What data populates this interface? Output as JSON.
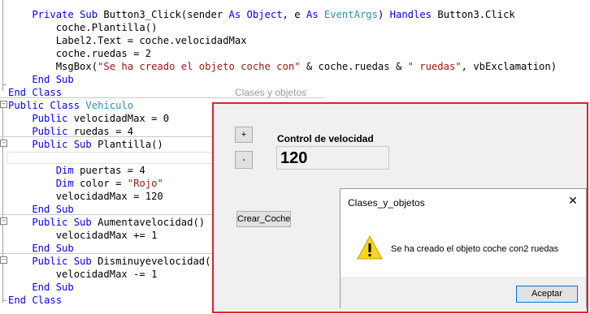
{
  "editor": {
    "lines": [
      {
        "segments": [
          {
            "t": "    Private Sub ",
            "c": "kw"
          },
          {
            "t": "Button3_Click(sender ",
            "c": ""
          },
          {
            "t": "As Object",
            "c": "kw"
          },
          {
            "t": ", e ",
            "c": ""
          },
          {
            "t": "As ",
            "c": "kw"
          },
          {
            "t": "EventArgs",
            "c": "ty"
          },
          {
            "t": ") ",
            "c": ""
          },
          {
            "t": "Handles ",
            "c": "kw"
          },
          {
            "t": "Button3.Click",
            "c": ""
          }
        ]
      },
      {
        "segments": [
          {
            "t": "        coche.Plantilla()",
            "c": ""
          }
        ]
      },
      {
        "segments": [
          {
            "t": "        Label2.Text = coche.velocidadMax",
            "c": ""
          }
        ]
      },
      {
        "segments": [
          {
            "t": "        coche.ruedas = 2",
            "c": ""
          }
        ]
      },
      {
        "segments": [
          {
            "t": "        MsgBox(",
            "c": ""
          },
          {
            "t": "\"Se ha creado el objeto coche con\"",
            "c": "str"
          },
          {
            "t": " & coche.ruedas & ",
            "c": ""
          },
          {
            "t": "\" ruedas\"",
            "c": "str"
          },
          {
            "t": ", vbExclamation)",
            "c": ""
          }
        ]
      },
      {
        "segments": [
          {
            "t": "    End Sub",
            "c": "kw"
          }
        ]
      },
      {
        "segments": [
          {
            "t": "End Class",
            "c": "kw"
          }
        ]
      },
      {
        "segments": [
          {
            "t": "Public Class ",
            "c": "kw"
          },
          {
            "t": "Vehiculo",
            "c": "ty"
          }
        ]
      },
      {
        "segments": [
          {
            "t": "    Public ",
            "c": "kw"
          },
          {
            "t": "velocidadMax = 0",
            "c": ""
          }
        ]
      },
      {
        "segments": [
          {
            "t": "    Public ",
            "c": "kw"
          },
          {
            "t": "ruedas = 4",
            "c": ""
          }
        ]
      },
      {
        "segments": [
          {
            "t": "    Public Sub ",
            "c": "kw"
          },
          {
            "t": "Plantilla()",
            "c": ""
          }
        ]
      },
      {
        "segments": [
          {
            "t": "",
            "c": ""
          }
        ]
      },
      {
        "segments": [
          {
            "t": "        Dim ",
            "c": "kw"
          },
          {
            "t": "puertas = 4",
            "c": ""
          }
        ]
      },
      {
        "segments": [
          {
            "t": "        Dim ",
            "c": "kw"
          },
          {
            "t": "color = ",
            "c": ""
          },
          {
            "t": "\"Rojo\"",
            "c": "str"
          }
        ]
      },
      {
        "segments": [
          {
            "t": "        velocidadMax = 120",
            "c": ""
          }
        ]
      },
      {
        "segments": [
          {
            "t": "    End Sub",
            "c": "kw"
          }
        ]
      },
      {
        "segments": [
          {
            "t": "    Public Sub ",
            "c": "kw"
          },
          {
            "t": "Aumentavelocidad()",
            "c": ""
          }
        ]
      },
      {
        "segments": [
          {
            "t": "        velocidadMax += 1",
            "c": ""
          }
        ]
      },
      {
        "segments": [
          {
            "t": "    End Sub",
            "c": "kw"
          }
        ]
      },
      {
        "segments": [
          {
            "t": "    Public Sub ",
            "c": "kw"
          },
          {
            "t": "Disminuyevelocidad()",
            "c": ""
          }
        ]
      },
      {
        "segments": [
          {
            "t": "        velocidadMax -= 1",
            "c": ""
          }
        ]
      },
      {
        "segments": [
          {
            "t": "    End Sub",
            "c": "kw"
          }
        ]
      },
      {
        "segments": [
          {
            "t": "End Class",
            "c": "kw"
          }
        ]
      }
    ]
  },
  "form": {
    "title": "Clases y objetos",
    "plus_label": "+",
    "minus_label": "-",
    "speed_label": "Control de velocidad",
    "speed_value": "120",
    "create_label": "Crear_Coche",
    "accent_color": "#e0202a"
  },
  "msgbox": {
    "title": "Clases_y_objetos",
    "close_glyph": "✕",
    "icon": "warning-icon",
    "message": "Se ha creado el objeto coche con2 ruedas",
    "ok_label": "Aceptar"
  }
}
